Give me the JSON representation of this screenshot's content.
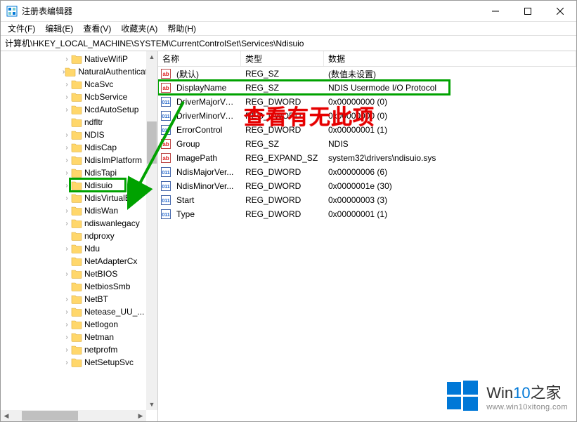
{
  "window": {
    "title": "注册表编辑器"
  },
  "menu": {
    "file": "文件(F)",
    "edit": "编辑(E)",
    "view": "查看(V)",
    "favorites": "收藏夹(A)",
    "help": "帮助(H)"
  },
  "address": {
    "value": "计算机\\HKEY_LOCAL_MACHINE\\SYSTEM\\CurrentControlSet\\Services\\Ndisuio"
  },
  "tree": {
    "items": [
      {
        "label": "NativeWifiP",
        "expandable": true
      },
      {
        "label": "NaturalAuthentication",
        "expandable": true
      },
      {
        "label": "NcaSvc",
        "expandable": true
      },
      {
        "label": "NcbService",
        "expandable": true
      },
      {
        "label": "NcdAutoSetup",
        "expandable": true
      },
      {
        "label": "ndfltr",
        "expandable": false
      },
      {
        "label": "NDIS",
        "expandable": true
      },
      {
        "label": "NdisCap",
        "expandable": true
      },
      {
        "label": "NdisImPlatform",
        "expandable": true
      },
      {
        "label": "NdisTapi",
        "expandable": true
      },
      {
        "label": "Ndisuio",
        "expandable": true,
        "selected": true
      },
      {
        "label": "NdisVirtualBus",
        "expandable": true
      },
      {
        "label": "NdisWan",
        "expandable": true
      },
      {
        "label": "ndiswanlegacy",
        "expandable": true
      },
      {
        "label": "ndproxy",
        "expandable": false
      },
      {
        "label": "Ndu",
        "expandable": true
      },
      {
        "label": "NetAdapterCx",
        "expandable": false
      },
      {
        "label": "NetBIOS",
        "expandable": true
      },
      {
        "label": "NetbiosSmb",
        "expandable": false
      },
      {
        "label": "NetBT",
        "expandable": true
      },
      {
        "label": "Netease_UU_...",
        "expandable": true
      },
      {
        "label": "Netlogon",
        "expandable": true
      },
      {
        "label": "Netman",
        "expandable": true
      },
      {
        "label": "netprofm",
        "expandable": true
      },
      {
        "label": "NetSetupSvc",
        "expandable": true
      }
    ]
  },
  "list": {
    "headers": {
      "name": "名称",
      "type": "类型",
      "data": "数据"
    },
    "rows": [
      {
        "icon": "sz",
        "name": "(默认)",
        "type": "REG_SZ",
        "data": "(数值未设置)"
      },
      {
        "icon": "sz",
        "name": "DisplayName",
        "type": "REG_SZ",
        "data": "NDIS Usermode I/O Protocol",
        "highlight": true
      },
      {
        "icon": "bin",
        "name": "DriverMajorVe...",
        "type": "REG_DWORD",
        "data": "0x00000000 (0)"
      },
      {
        "icon": "bin",
        "name": "DriverMinorVe...",
        "type": "REG_DWORD",
        "data": "0x00000000 (0)"
      },
      {
        "icon": "bin",
        "name": "ErrorControl",
        "type": "REG_DWORD",
        "data": "0x00000001 (1)"
      },
      {
        "icon": "sz",
        "name": "Group",
        "type": "REG_SZ",
        "data": "NDIS"
      },
      {
        "icon": "sz",
        "name": "ImagePath",
        "type": "REG_EXPAND_SZ",
        "data": "system32\\drivers\\ndisuio.sys"
      },
      {
        "icon": "bin",
        "name": "NdisMajorVer...",
        "type": "REG_DWORD",
        "data": "0x00000006 (6)"
      },
      {
        "icon": "bin",
        "name": "NdisMinorVer...",
        "type": "REG_DWORD",
        "data": "0x0000001e (30)"
      },
      {
        "icon": "bin",
        "name": "Start",
        "type": "REG_DWORD",
        "data": "0x00000003 (3)"
      },
      {
        "icon": "bin",
        "name": "Type",
        "type": "REG_DWORD",
        "data": "0x00000001 (1)"
      }
    ]
  },
  "annotation": {
    "text": "查看有无此项"
  },
  "watermark": {
    "brand_prefix": "Win",
    "brand_accent": "10",
    "brand_suffix": "之家",
    "url": "www.win10xitong.com"
  }
}
